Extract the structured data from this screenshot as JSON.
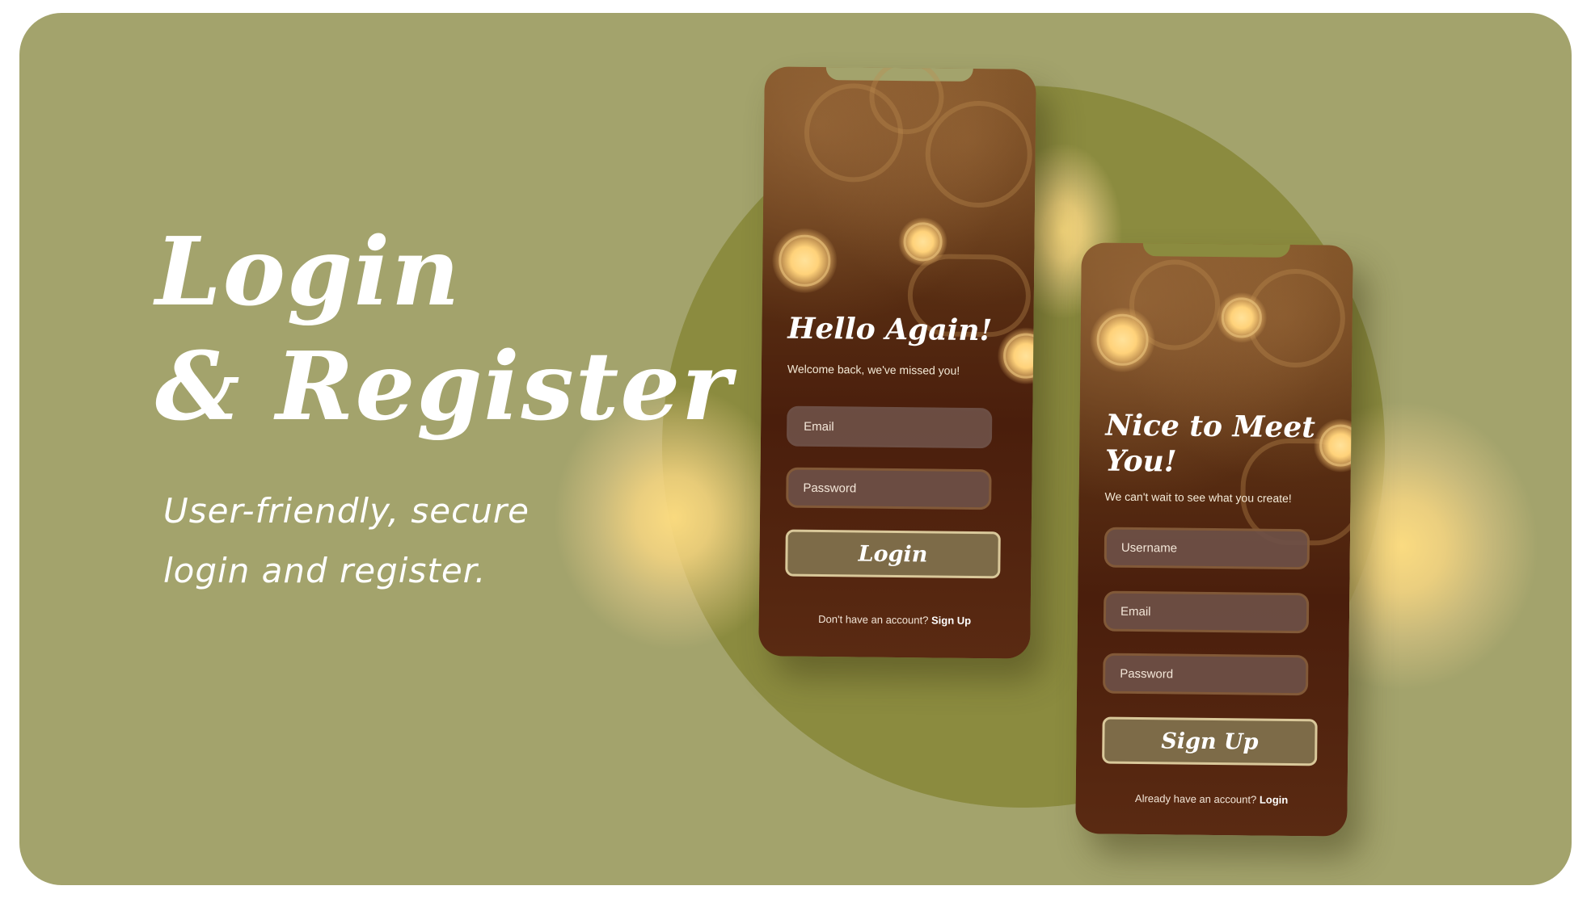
{
  "hero": {
    "title_line1": "Login",
    "title_line2": "& Register",
    "subtitle": "User-friendly, secure login and register."
  },
  "login_screen": {
    "title": "Hello Again!",
    "subtitle": "Welcome back, we've missed you!",
    "email_placeholder": "Email",
    "password_placeholder": "Password",
    "button_label": "Login",
    "footer_text": "Don't have an account?",
    "footer_link": "Sign Up"
  },
  "register_screen": {
    "title_line1": "Nice to Meet",
    "title_line2": "You!",
    "subtitle": "We can't wait to see what you create!",
    "username_placeholder": "Username",
    "email_placeholder": "Email",
    "password_placeholder": "Password",
    "button_label": "Sign Up",
    "footer_text": "Already have an account?",
    "footer_link": "Login"
  },
  "colors": {
    "background": "#a3a36c",
    "circle": "#8b8b3f",
    "phone_dark": "#4a1e0c",
    "accent_glow": "#ffd27a"
  }
}
